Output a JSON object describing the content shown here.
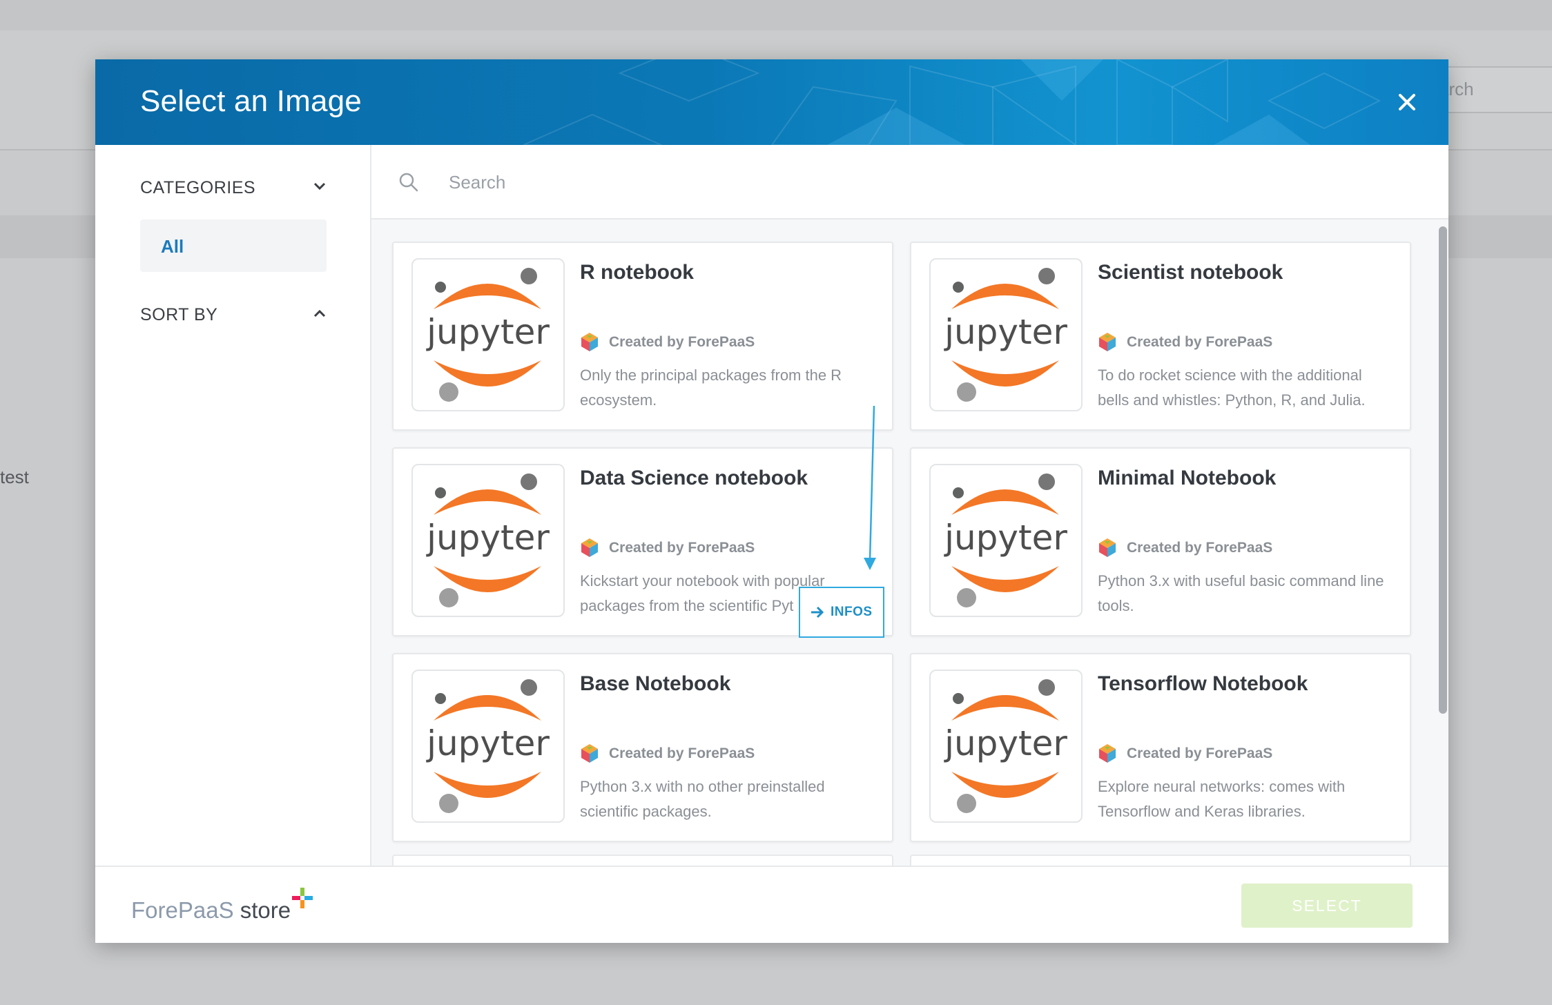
{
  "background": {
    "search_placeholder_fragment": "arch",
    "side_text_fragment": "test"
  },
  "modal": {
    "title": "Select an Image",
    "close_icon": "close-icon"
  },
  "sidebar": {
    "categories_label": "CATEGORIES",
    "categories_item": "All",
    "sort_label": "SORT BY"
  },
  "search": {
    "placeholder": "Search"
  },
  "cards": [
    {
      "title": "R notebook",
      "creator": "Created by ForePaaS",
      "description": "Only the principal packages from the R ecosystem.",
      "logo": "jupyter"
    },
    {
      "title": "Scientist notebook",
      "creator": "Created by ForePaaS",
      "description": "To do rocket science with the additional bells and whistles: Python, R, and Julia.",
      "logo": "jupyter"
    },
    {
      "title": "Data Science notebook",
      "creator": "Created by ForePaaS",
      "description": "Kickstart your notebook with popular packages from the scientific Pyt",
      "logo": "jupyter"
    },
    {
      "title": "Minimal Notebook",
      "creator": "Created by ForePaaS",
      "description": "Python 3.x with useful basic command line tools.",
      "logo": "jupyter"
    },
    {
      "title": "Base Notebook",
      "creator": "Created by ForePaaS",
      "description": "Python 3.x with no other preinstalled scientific packages.",
      "logo": "jupyter"
    },
    {
      "title": "Tensorflow Notebook",
      "creator": "Created by ForePaaS",
      "description": "Explore neural networks: comes with Tensorflow and Keras libraries.",
      "logo": "jupyter"
    }
  ],
  "infos_button": {
    "label": "INFOS"
  },
  "footer": {
    "brand_primary": "ForePaaS",
    "brand_secondary": "store",
    "select_label": "SELECT"
  },
  "colors": {
    "header_blue": "#0b78b6",
    "accent_blue": "#1b7bbd",
    "jupyter_orange": "#f37726",
    "select_disabled": "#dff1c9"
  }
}
